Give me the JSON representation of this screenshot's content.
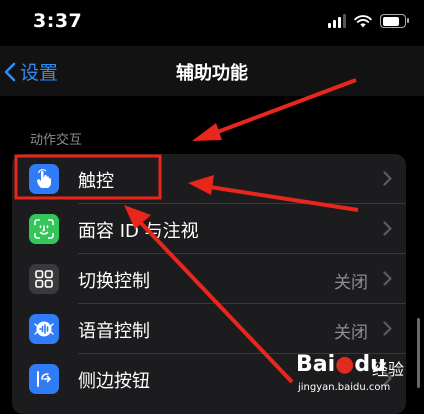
{
  "status_bar": {
    "time": "3:37"
  },
  "nav": {
    "back_label": "设置",
    "title": "辅助功能"
  },
  "section": {
    "header": "动作交互"
  },
  "items": [
    {
      "label": "触控",
      "value": "",
      "icon": "hand-touch-icon",
      "icon_color": "#2f7cf6"
    },
    {
      "label": "面容 ID 与注视",
      "value": "",
      "icon": "face-id-icon",
      "icon_color": "#35c659"
    },
    {
      "label": "切换控制",
      "value": "关闭",
      "icon": "switch-control-icon",
      "icon_color": "#3a3a3c"
    },
    {
      "label": "语音控制",
      "value": "关闭",
      "icon": "voice-control-icon",
      "icon_color": "#2f7cf6"
    },
    {
      "label": "侧边按钮",
      "value": "",
      "icon": "side-button-icon",
      "icon_color": "#2f7cf6"
    }
  ],
  "watermark": {
    "logo": "Bai",
    "logo_tail": "du",
    "name": "经验",
    "url": "jingyan.baidu.com"
  },
  "colors": {
    "accent": "#2f8cf5",
    "annotation_red": "#e8261c",
    "group_bg": "#1c1c1e"
  }
}
